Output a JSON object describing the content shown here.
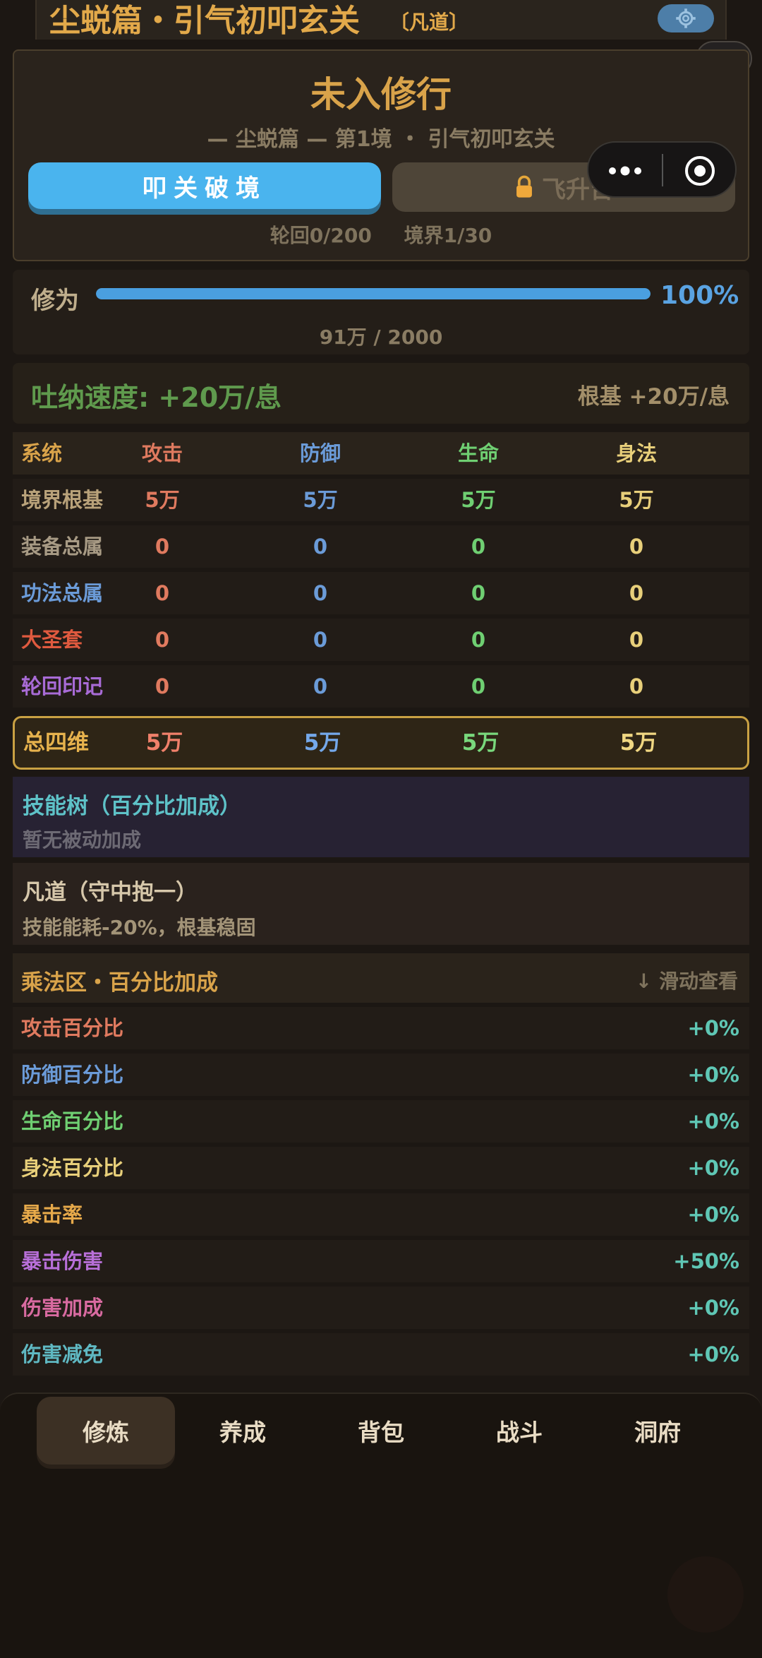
{
  "header": {
    "title": "尘蜕篇・引气初叩玄关",
    "tag": "〔凡道〕",
    "settings_icon": "gear-icon",
    "info_label": "i"
  },
  "realm": {
    "title": "未入修行",
    "subtitle": "— 尘蜕篇 —  第1境 ・ 引气初叩玄关",
    "breach_label": "叩关破境",
    "ascend_label": "飞升台",
    "ascend_icon": "lock-icon",
    "reincarnation": "轮回0/200",
    "stage": "境界1/30"
  },
  "cultivation": {
    "label": "修为",
    "percent_text": "100%",
    "progress": 1.0,
    "value": "91万 / 2000"
  },
  "speed": {
    "text": "吐纳速度: +20万/息",
    "base": "根基 +20万/息"
  },
  "stats": {
    "headers": [
      "系统",
      "攻击",
      "防御",
      "生命",
      "身法"
    ],
    "rows": [
      {
        "label": "境界根基",
        "values": [
          "5万",
          "5万",
          "5万",
          "5万"
        ]
      },
      {
        "label": "装备总属",
        "values": [
          "0",
          "0",
          "0",
          "0"
        ]
      },
      {
        "label": "功法总属",
        "values": [
          "0",
          "0",
          "0",
          "0"
        ]
      },
      {
        "label": "大圣套",
        "values": [
          "0",
          "0",
          "0",
          "0"
        ]
      },
      {
        "label": "轮回印记",
        "values": [
          "0",
          "0",
          "0",
          "0"
        ]
      }
    ],
    "total": {
      "label": "总四维",
      "values": [
        "5万",
        "5万",
        "5万",
        "5万"
      ]
    }
  },
  "skill_tree": {
    "title": "技能树（百分比加成）",
    "desc": "暂无被动加成"
  },
  "dao": {
    "title": "凡道（守中抱一）",
    "desc": "技能能耗-20%，根基稳固"
  },
  "multiplier": {
    "title": "乘法区・百分比加成",
    "hint": "↓ 滑动查看",
    "items": [
      {
        "label": "攻击百分比",
        "value": "+0%"
      },
      {
        "label": "防御百分比",
        "value": "+0%"
      },
      {
        "label": "生命百分比",
        "value": "+0%"
      },
      {
        "label": "身法百分比",
        "value": "+0%"
      },
      {
        "label": "暴击率",
        "value": "+0%"
      },
      {
        "label": "暴击伤害",
        "value": "+50%"
      },
      {
        "label": "伤害加成",
        "value": "+0%"
      },
      {
        "label": "伤害减免",
        "value": "+0%"
      }
    ]
  },
  "nav": {
    "items": [
      "修炼",
      "养成",
      "背包",
      "战斗",
      "洞府"
    ],
    "active": "修炼"
  },
  "colors": {
    "attack": "#e07a5f",
    "defense": "#6b9bd8",
    "life": "#6fcf72",
    "agility": "#e8cf7a",
    "gold": "#d9a34a",
    "purple": "#a86bd6",
    "teal": "#5fc7b5"
  }
}
